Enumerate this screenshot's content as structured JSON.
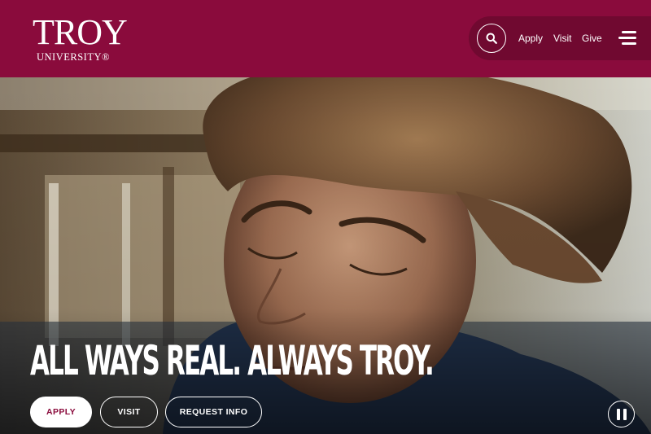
{
  "brand": {
    "name": "TROY",
    "subtitle": "UNIVERSITY®",
    "color": "#8a0b3c"
  },
  "utility_nav": {
    "search_icon": "search-icon",
    "links": [
      "Apply",
      "Visit",
      "Give"
    ],
    "menu_icon": "hamburger-menu-icon"
  },
  "hero": {
    "headline": "ALL WAYS REAL. ALWAYS TROY.",
    "buttons": {
      "apply": "APPLY",
      "visit": "VISIT",
      "request_info": "REQUEST INFO"
    },
    "pause_icon": "pause-icon"
  }
}
